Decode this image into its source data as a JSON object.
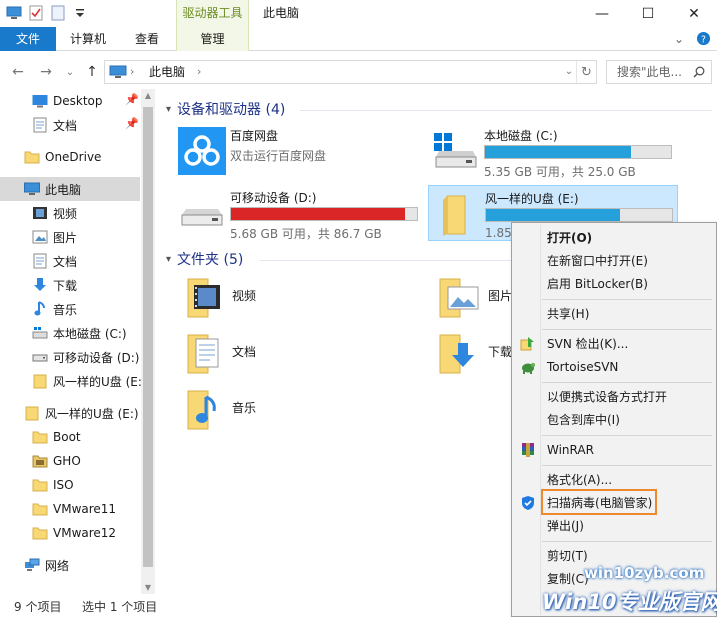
{
  "titlebar": {
    "context_tab": "驱动器工具",
    "title": "此电脑",
    "minimize": "—",
    "maximize": "☐",
    "close": "✕"
  },
  "ribbon": {
    "tabs": [
      "文件",
      "计算机",
      "查看",
      "管理"
    ],
    "expand": "⌄",
    "help": "?"
  },
  "address": {
    "back": "←",
    "forward": "→",
    "recent": "⌄",
    "up": "↑",
    "sep": "›",
    "crumb": "此电脑",
    "dropdown": "⌄",
    "refresh": "↻",
    "search_placeholder": "搜索\"此电..."
  },
  "nav": {
    "items": [
      {
        "label": "Desktop",
        "icon": "desktop-icon",
        "pinned": true
      },
      {
        "label": "文档",
        "icon": "documents-icon",
        "pinned": true
      },
      {
        "label": "OneDrive",
        "icon": "onedrive-folder-icon"
      },
      {
        "label": "此电脑",
        "icon": "this-pc-icon",
        "selected": true
      },
      {
        "label": "视频",
        "icon": "videos-icon"
      },
      {
        "label": "图片",
        "icon": "pictures-icon"
      },
      {
        "label": "文档",
        "icon": "documents-icon"
      },
      {
        "label": "下载",
        "icon": "downloads-icon"
      },
      {
        "label": "音乐",
        "icon": "music-icon"
      },
      {
        "label": "本地磁盘 (C:)",
        "icon": "local-disk-icon"
      },
      {
        "label": "可移动设备 (D:)",
        "icon": "removable-drive-icon"
      },
      {
        "label": "风一样的U盘 (E:",
        "icon": "folder-icon"
      },
      {
        "label": "风一样的U盘 (E:)",
        "icon": "folder-icon"
      },
      {
        "label": "Boot",
        "icon": "folder-icon"
      },
      {
        "label": "GHO",
        "icon": "folder-icon"
      },
      {
        "label": "ISO",
        "icon": "folder-icon"
      },
      {
        "label": "VMware11",
        "icon": "folder-icon"
      },
      {
        "label": "VMware12",
        "icon": "folder-icon"
      },
      {
        "label": "网络",
        "icon": "network-icon"
      }
    ],
    "pin_glyph": "📌"
  },
  "content": {
    "devices_header": "设备和驱动器 (4)",
    "folders_header": "文件夹 (5)",
    "devices": [
      {
        "name": "百度网盘",
        "subtitle": "双击运行百度网盘",
        "icon": "baidu-netdisk-icon"
      },
      {
        "name": "本地磁盘 (C:)",
        "info": "5.35 GB 可用，共 25.0 GB",
        "used_fraction": 0.786,
        "icon": "local-disk-icon"
      },
      {
        "name": "可移动设备 (D:)",
        "info": "5.68 GB 可用，共 86.7 GB",
        "used_fraction": 0.934,
        "icon": "removable-drive-icon",
        "bar_color": "#da2626"
      },
      {
        "name": "风一样的U盘 (E:)",
        "info": "1.85",
        "used_fraction": 0.72,
        "icon": "usb-folder-icon",
        "selected": true
      }
    ],
    "folders": [
      {
        "name": "视频",
        "icon": "videos-folder-icon"
      },
      {
        "name": "图片",
        "icon": "pictures-folder-icon"
      },
      {
        "name": "文档",
        "icon": "documents-folder-icon"
      },
      {
        "name": "下载",
        "icon": "downloads-folder-icon"
      },
      {
        "name": "音乐",
        "icon": "music-folder-icon"
      }
    ]
  },
  "status": {
    "count": "9 个项目",
    "selected": "选中 1 个项目"
  },
  "context_menu": {
    "items": [
      {
        "label": "打开(O)",
        "bold": true
      },
      {
        "label": "在新窗口中打开(E)"
      },
      {
        "label": "启用 BitLocker(B)"
      },
      {
        "label": "共享(H)"
      },
      {
        "label": "SVN 检出(K)...",
        "icon": "svn-checkout-icon"
      },
      {
        "label": "TortoiseSVN",
        "icon": "tortoisesvn-icon"
      },
      {
        "label": "以便携式设备方式打开"
      },
      {
        "label": "包含到库中(I)"
      },
      {
        "label": "WinRAR",
        "icon": "winrar-icon"
      },
      {
        "label": "格式化(A)..."
      },
      {
        "label": "扫描病毒(电脑管家)",
        "icon": "tencent-pc-manager-icon",
        "highlighted": true
      },
      {
        "label": "弹出(J)"
      },
      {
        "label": "剪切(T)"
      },
      {
        "label": "复制(C)"
      }
    ]
  },
  "watermark": {
    "url": "win10zyb.com",
    "brand": "Win10专业版官网"
  },
  "colors": {
    "accent": "#1979ca",
    "bar_blue": "#26a0da",
    "bar_red": "#da2626",
    "selection": "#cce8ff",
    "highlight_border": "#f0882d"
  }
}
